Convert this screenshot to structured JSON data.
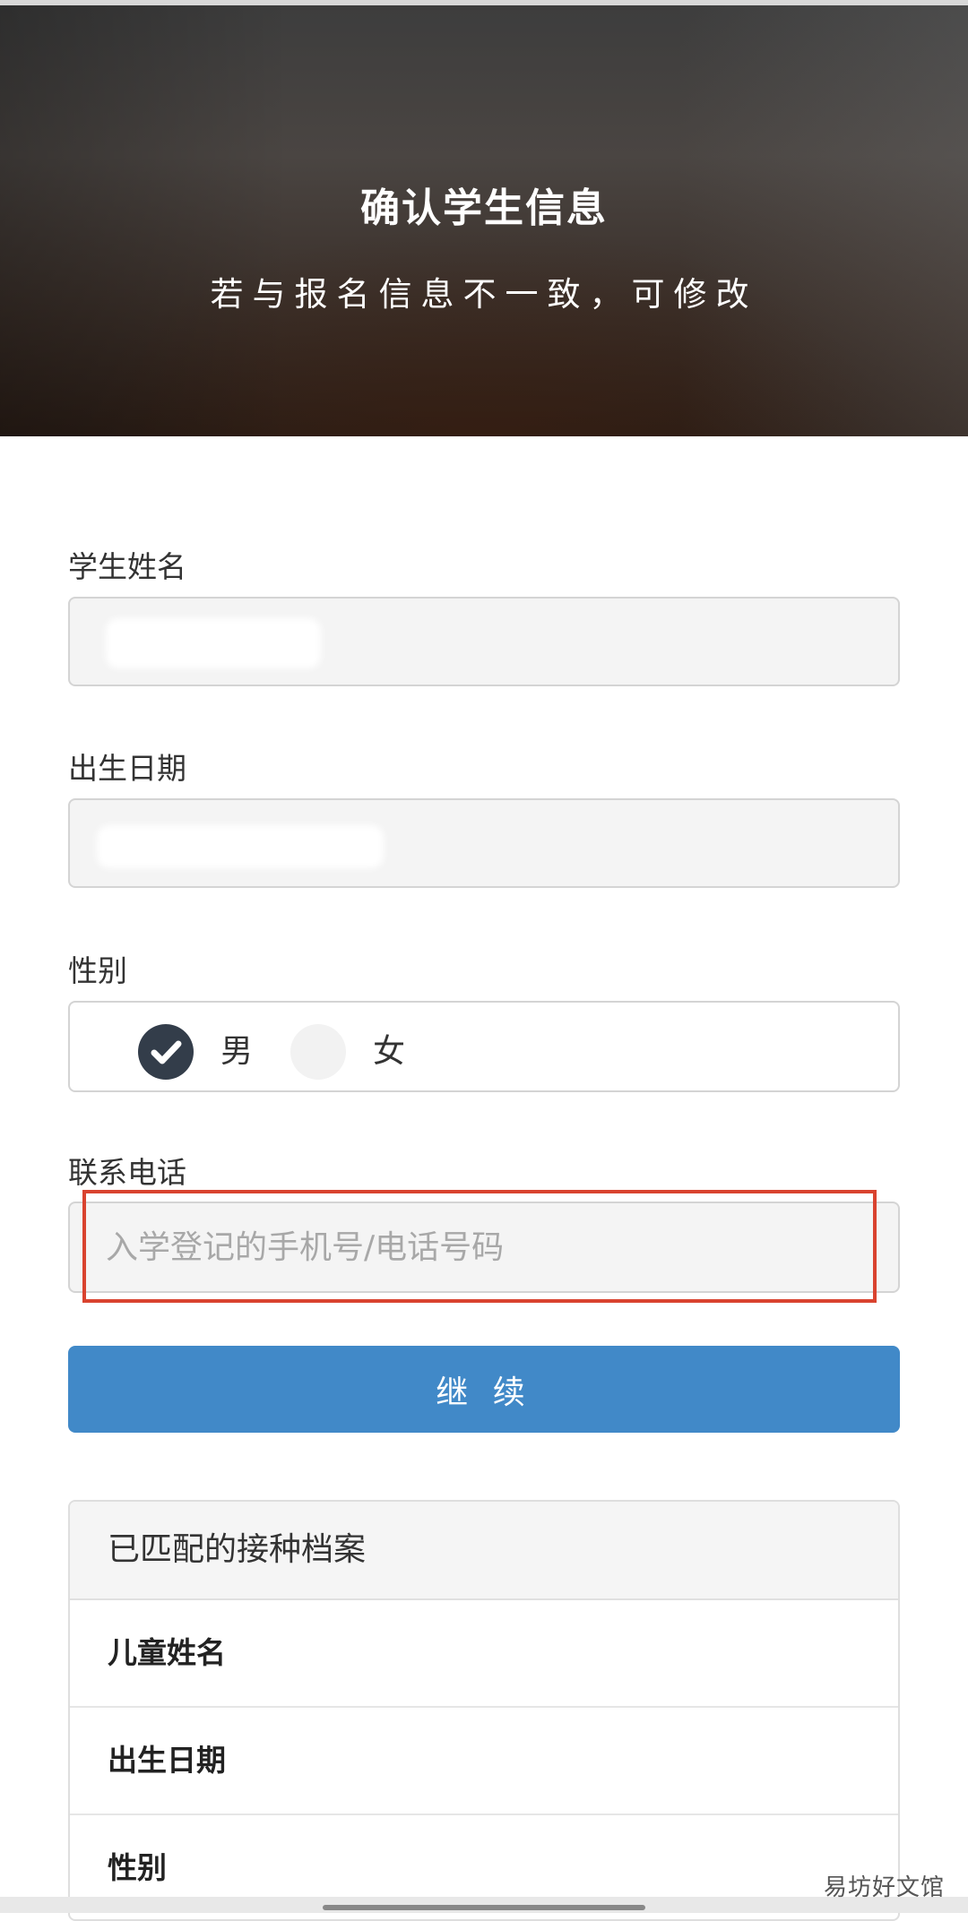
{
  "header": {
    "title": "确认学生信息",
    "subtitle": "若与报名信息不一致，可修改"
  },
  "form": {
    "student_name": {
      "label": "学生姓名",
      "value": ""
    },
    "birth_date": {
      "label": "出生日期",
      "value": ""
    },
    "gender": {
      "label": "性别",
      "options": [
        "男",
        "女"
      ],
      "selected": "男"
    },
    "phone": {
      "label": "联系电话",
      "placeholder": "入学登记的手机号/电话号码",
      "value": ""
    },
    "continue_label": "继 续"
  },
  "records": {
    "title": "已匹配的接种档案",
    "rows": [
      {
        "label": "儿童姓名",
        "value": ""
      },
      {
        "label": "出生日期",
        "value": ""
      },
      {
        "label": "性别",
        "value": ""
      }
    ]
  },
  "watermark": "易坊好文馆",
  "colors": {
    "primary_button": "#4189c8",
    "highlight_border": "#d9432f",
    "checked_radio": "#333d4a"
  }
}
